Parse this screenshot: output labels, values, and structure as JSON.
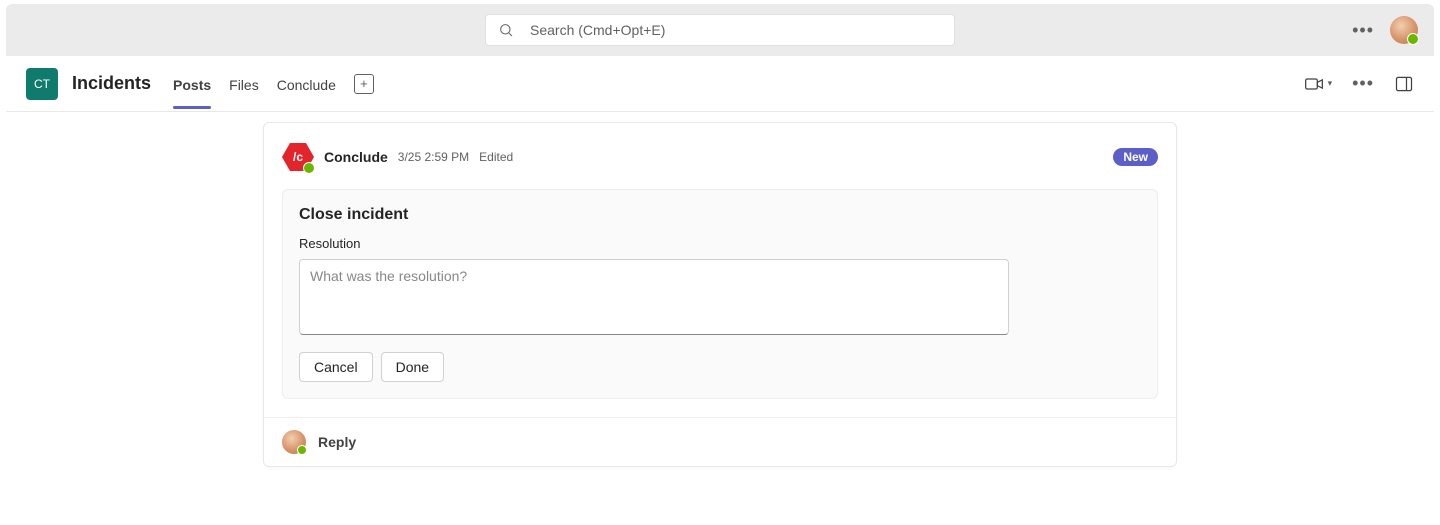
{
  "search": {
    "placeholder": "Search (Cmd+Opt+E)"
  },
  "channel": {
    "icon_text": "CT",
    "title": "Incidents",
    "tabs": [
      {
        "label": "Posts",
        "active": true
      },
      {
        "label": "Files",
        "active": false
      },
      {
        "label": "Conclude",
        "active": false
      }
    ]
  },
  "post": {
    "app_icon_text": "/c",
    "author": "Conclude",
    "timestamp": "3/25 2:59 PM",
    "edited_label": "Edited",
    "badge": "New"
  },
  "form": {
    "title": "Close incident",
    "field_label": "Resolution",
    "placeholder": "What was the resolution?",
    "cancel_label": "Cancel",
    "done_label": "Done"
  },
  "reply": {
    "label": "Reply"
  }
}
